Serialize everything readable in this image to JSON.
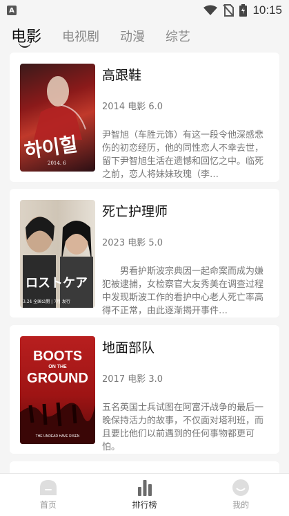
{
  "status": {
    "time": "10:15",
    "app_badge": "A"
  },
  "tabs": [
    {
      "label": "电影",
      "active": true
    },
    {
      "label": "电视剧",
      "active": false
    },
    {
      "label": "动漫",
      "active": false
    },
    {
      "label": "综艺",
      "active": false
    }
  ],
  "movies": [
    {
      "title": "高跟鞋",
      "meta": "2014 电影 6.0",
      "desc": "尹智旭（车胜元饰）有这一段令他深感悲伤的初恋经历，他的同性恋人不幸去世，留下尹智旭生活在遗憾和回忆之中。临死之前，恋人将妹妹玫瑰（李…",
      "poster_text": "하이힐",
      "poster_small": "2014. 6"
    },
    {
      "title": "死亡护理师",
      "meta": "2023 电影 5.0",
      "desc": "男看护斯波宗典因一起命案而成为嫌犯被逮捕，女检察官大友秀美在调查过程中发现斯波工作的看护中心老人死亡率高得不正常，由此逐渐揭开事件…",
      "poster_text": "ロストケア",
      "poster_small": "3.24 全国公開 | 7月 发行"
    },
    {
      "title": "地面部队",
      "meta": "2017 电影 3.0",
      "desc": "五名英国士兵试图在阿富汗战争的最后一晚保持活力的故事，不仅面对塔利班，而且要比他们以前遇到的任何事物都更可怕。",
      "poster_line1": "BOOTS",
      "poster_line2": "ON THE",
      "poster_line3": "GROUND",
      "poster_small": "THE UNDEAD HAVE RISEN"
    }
  ],
  "bottom_nav": [
    {
      "label": "首页",
      "icon": "home-icon",
      "active": false
    },
    {
      "label": "排行榜",
      "icon": "ranking-icon",
      "active": true
    },
    {
      "label": "我的",
      "icon": "profile-icon",
      "active": false
    }
  ]
}
